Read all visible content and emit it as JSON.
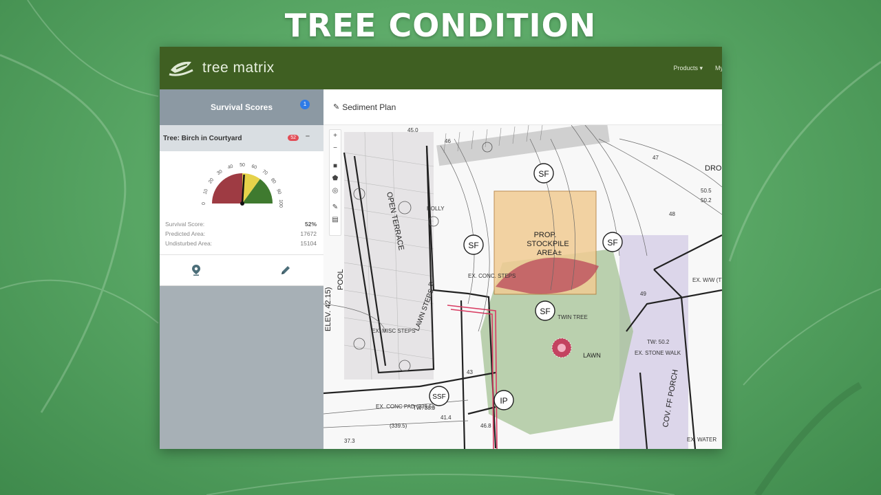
{
  "headline": "TREE CONDITION",
  "navbar": {
    "brand": "tree matrix",
    "products": "Products ▾",
    "truncated_link": "My"
  },
  "sidebar": {
    "title": "Survival Scores",
    "badge": "1",
    "tree": {
      "label": "Tree: Birch in Courtyard",
      "badge": "52",
      "collapse": "–"
    },
    "gauge": {
      "ticks": [
        "0",
        "10",
        "20",
        "30",
        "40",
        "50",
        "60",
        "70",
        "80",
        "90",
        "100"
      ],
      "value": 52,
      "colors": {
        "red": "#9e3b43",
        "yellow": "#e6d24a",
        "green": "#3f7a2f"
      }
    },
    "stats": [
      {
        "label": "Survival Score:",
        "value": "52%"
      },
      {
        "label": "Predicted Area:",
        "value": "17672"
      },
      {
        "label": "Undisturbed Area:",
        "value": "15104"
      }
    ],
    "actions": {
      "locate": "map-marker-icon",
      "edit": "pencil-icon"
    }
  },
  "main": {
    "title": "Sediment Plan",
    "toolbar": [
      "+",
      "−",
      "■",
      "⬟",
      "◎",
      "✎",
      "▤"
    ]
  },
  "plan_labels": {
    "stockpile": [
      "PROP.",
      "STOCKPILE",
      "AREA±"
    ],
    "sf": "SF",
    "ssf": "SSF",
    "ip": "IP",
    "lawn": "LAWN",
    "open_terrace": "OPEN TERRACE",
    "pool": "POOL",
    "elev": "ELEV. 42.15)",
    "lawn_steps": "LAWN STEPS",
    "cov_porch": "COV. FF PORCH",
    "ex_conc_steps": "EX. CONC. STEPS",
    "ex_stone_walk": "EX. STONE WALK",
    "ex_misc_steps": "EX. MISC STEPS",
    "ex_conc_pad": "EX. CONC PAD (339.5)",
    "ex_water": "EX. WATER",
    "ex_ww": "EX. W/W (TYP.)",
    "holly": "HOLLY",
    "twin_tree": "TWIN TREE",
    "dro": "DRO",
    "n45": "45.0",
    "n46": "46",
    "n47": "47",
    "n48": "48",
    "n49": "49",
    "n42": "42",
    "n43": "43",
    "n505": "50.5",
    "n502": "50.2",
    "n3395": "(339.5)",
    "n468": "46.8",
    "n414": "41.4",
    "n373": "37.3",
    "tw": "TW: 50.2",
    "tw2": "TW: 38.9"
  }
}
